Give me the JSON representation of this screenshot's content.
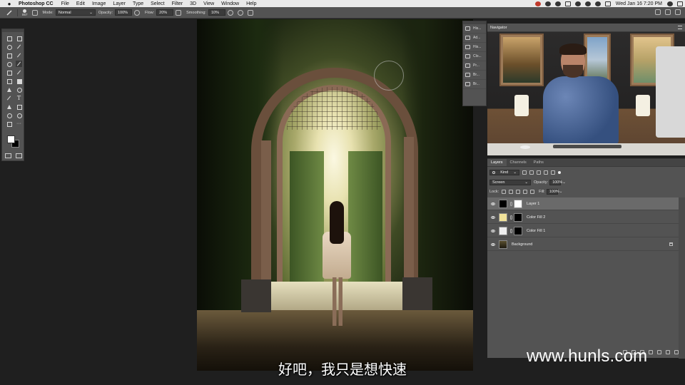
{
  "menubar": {
    "app_name": "Photoshop CC",
    "items": [
      "File",
      "Edit",
      "Image",
      "Layer",
      "Type",
      "Select",
      "Filter",
      "3D",
      "View",
      "Window",
      "Help"
    ],
    "datetime": "Wed Jan 16  7:20 PM"
  },
  "options_bar": {
    "brush_size": "867",
    "mode_label": "Mode:",
    "mode_value": "Normal",
    "opacity_label": "Opacity:",
    "opacity_value": "100%",
    "flow_label": "Flow:",
    "flow_value": "20%",
    "smoothing_label": "Smoothing:",
    "smoothing_value": "10%"
  },
  "toolbar": {
    "foreground_color": "#ffffff",
    "background_color": "#000000"
  },
  "panel_strip": {
    "items": [
      "His...",
      "Ad...",
      "His...",
      "Clo...",
      "Pr...",
      "Br...",
      "Br..."
    ]
  },
  "navigator": {
    "tab_label": "Navigator"
  },
  "layers_panel": {
    "tabs": [
      "Layers",
      "Channels",
      "Paths"
    ],
    "filter_value": "Kind",
    "blend_mode": "Screen",
    "opacity_label": "Opacity:",
    "opacity_value": "100%",
    "lock_label": "Lock:",
    "fill_label": "Fill:",
    "fill_value": "100%",
    "layers": [
      {
        "name": "Layer 1",
        "selected": true,
        "thumb": "#000000",
        "mask": "#ffffff"
      },
      {
        "name": "Color Fill 2",
        "selected": false,
        "thumb": "#f1e39a",
        "mask": "#000000"
      },
      {
        "name": "Color Fill 1",
        "selected": false,
        "thumb": "#eeeeee",
        "mask": "#000000"
      },
      {
        "name": "Background",
        "selected": false,
        "thumb": "#3b3020",
        "mask": null
      }
    ]
  },
  "subtitle": "好吧，我只是想快速",
  "watermark": "www.hunls.com"
}
